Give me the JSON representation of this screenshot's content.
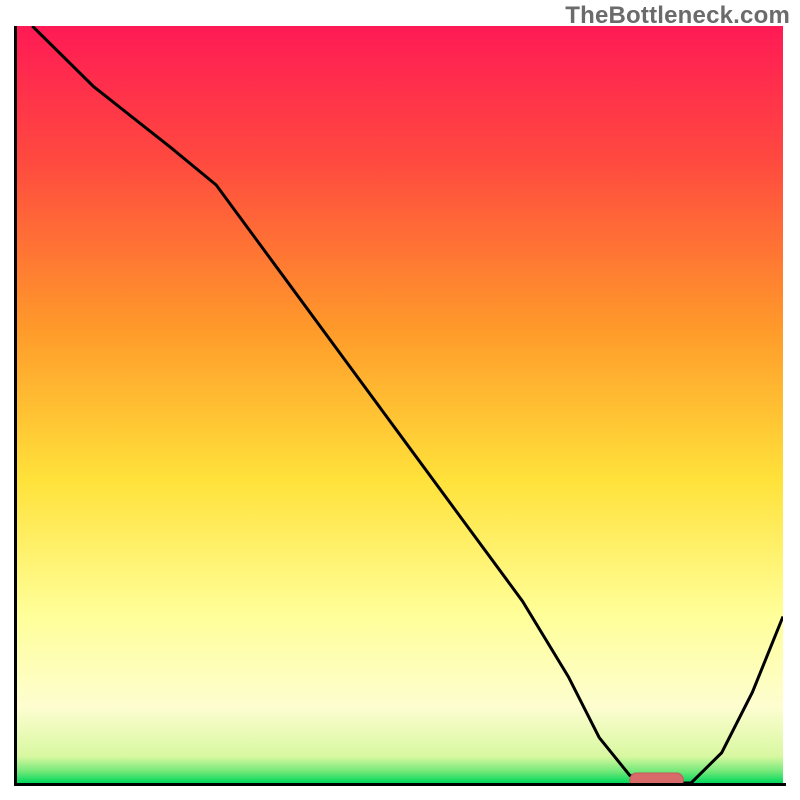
{
  "watermark": "TheBottleneck.com",
  "colors": {
    "curve": "#000000",
    "marker_fill": "#d96a6a",
    "marker_stroke": "#c55a5a",
    "grad_top": "#ff1a55",
    "grad_mid1": "#ff9a2a",
    "grad_mid2": "#ffe23a",
    "grad_mid3": "#ffff9a",
    "grad_mid4": "#fdfdd0",
    "grad_bottom": "#00e060"
  },
  "chart_data": {
    "type": "line",
    "title": "",
    "xlabel": "",
    "ylabel": "",
    "xlim": [
      0,
      100
    ],
    "ylim": [
      0,
      100
    ],
    "x": [
      2,
      10,
      20,
      26,
      34,
      42,
      50,
      58,
      66,
      72,
      76,
      80,
      84,
      88,
      92,
      96,
      100
    ],
    "y": [
      100,
      92,
      84,
      79,
      68,
      57,
      46,
      35,
      24,
      14,
      6,
      1,
      0,
      0,
      4,
      12,
      22
    ],
    "marker": {
      "x_start": 80,
      "x_end": 87,
      "y": 0
    },
    "gradient_stops": [
      {
        "pos": 0.0,
        "color": "#ff1a55"
      },
      {
        "pos": 0.18,
        "color": "#ff4a3f"
      },
      {
        "pos": 0.4,
        "color": "#ff9a2a"
      },
      {
        "pos": 0.6,
        "color": "#ffe23a"
      },
      {
        "pos": 0.78,
        "color": "#ffff9a"
      },
      {
        "pos": 0.9,
        "color": "#fdfdd0"
      },
      {
        "pos": 0.965,
        "color": "#d8f8a0"
      },
      {
        "pos": 0.985,
        "color": "#70e878"
      },
      {
        "pos": 1.0,
        "color": "#00d85c"
      }
    ]
  }
}
